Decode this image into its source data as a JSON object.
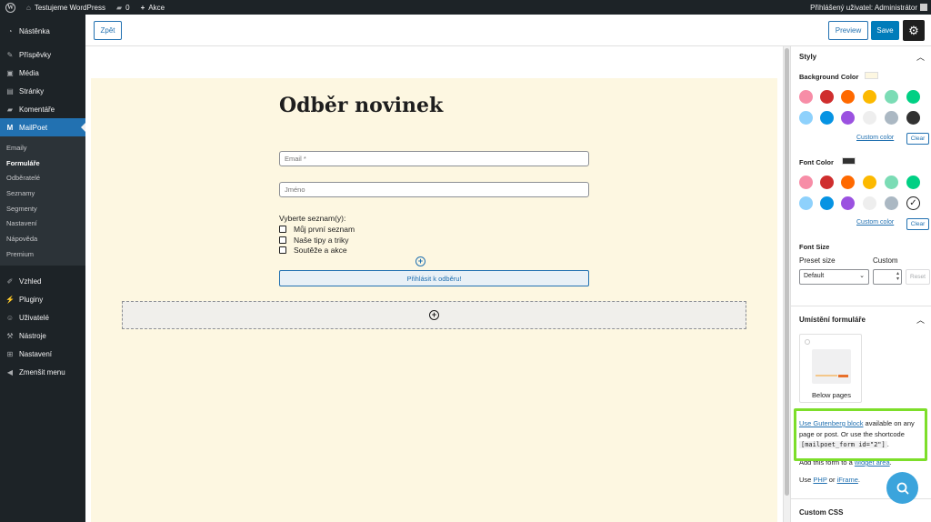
{
  "adminbar": {
    "site_name": "Testujeme WordPress",
    "comments_count": "0",
    "new_label": "Akce",
    "user_greeting": "Přihlášený uživatel: Administrátor"
  },
  "menu": {
    "items_top": [
      {
        "label": "Nástěnka",
        "icon": "dashboard-icon"
      },
      {
        "label": "Příspěvky",
        "icon": "pin-icon"
      },
      {
        "label": "Média",
        "icon": "media-icon"
      },
      {
        "label": "Stránky",
        "icon": "pages-icon"
      },
      {
        "label": "Komentáře",
        "icon": "comments-icon"
      },
      {
        "label": "MailPoet",
        "icon": "mailpoet-icon"
      }
    ],
    "submenu": [
      "Emaily",
      "Formuláře",
      "Odběratelé",
      "Seznamy",
      "Segmenty",
      "Nastavení",
      "Nápověda",
      "Premium"
    ],
    "submenu_current": "Formuláře",
    "items_bottom": [
      {
        "label": "Vzhled",
        "icon": "appearance-icon"
      },
      {
        "label": "Pluginy",
        "icon": "plugins-icon"
      },
      {
        "label": "Uživatelé",
        "icon": "users-icon"
      },
      {
        "label": "Nástroje",
        "icon": "tools-icon"
      },
      {
        "label": "Nastavení",
        "icon": "settings-icon"
      },
      {
        "label": "Zmenšit menu",
        "icon": "collapse-icon"
      }
    ]
  },
  "editor": {
    "back_label": "Zpět",
    "preview_label": "Preview",
    "save_label": "Save"
  },
  "form": {
    "title": "Odběr novinek",
    "email_placeholder": "Email *",
    "name_placeholder": "Jméno",
    "lists_label": "Vyberte seznam(y):",
    "lists": [
      "Můj první seznam",
      "Naše tipy a triky",
      "Soutěže a akce"
    ],
    "submit_label": "Přihlásit k odběru!"
  },
  "sidebar": {
    "styles_title": "Styly",
    "bg_color_label": "Background Color",
    "bg_color_value": "#fdf7e1",
    "palette": [
      "#f78da7",
      "#cf2e2e",
      "#ff6900",
      "#fcb900",
      "#7bdcb5",
      "#00d084",
      "#8ed1fc",
      "#0693e3",
      "#9b51e0",
      "#eeeeee",
      "#abb8c3",
      "#313131"
    ],
    "custom_color_label": "Custom color",
    "clear_label": "Clear",
    "font_color_label": "Font Color",
    "font_color_value": "#313131",
    "font_size_label": "Font Size",
    "preset_size_label": "Preset size",
    "custom_label": "Custom",
    "preset_value": "Default",
    "reset_label": "Reset",
    "placement_title": "Umístění formuláře",
    "placement_option": "Below pages",
    "gutenberg_link": "Use Gutenberg block",
    "gutenberg_text": " available on any page or post. Or use the shortcode ",
    "shortcode": "[mailpoet_form id=\"2\"]",
    "shortcode_end": ".",
    "widget_text": "Add this form to a ",
    "widget_link": "widget area",
    "widget_end": ".",
    "use_text": "Use ",
    "php_link": "PHP",
    "or_text": " or ",
    "iframe_link": "iFrame",
    "use_end": ".",
    "custom_css_title": "Custom CSS"
  }
}
